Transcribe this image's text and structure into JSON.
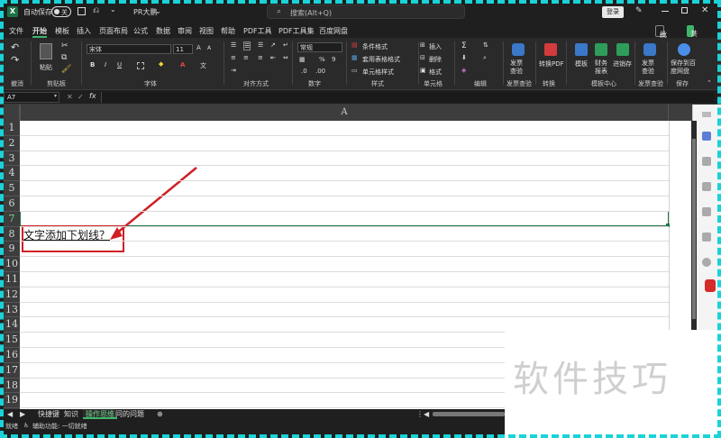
{
  "titlebar": {
    "autosave_label": "自动保存",
    "autosave_state": "关",
    "filename": "PR大鹏",
    "search_placeholder": "搜索(Alt+Q)",
    "login": "登录"
  },
  "tabs": [
    "文件",
    "开始",
    "模板",
    "插入",
    "页面布局",
    "公式",
    "数据",
    "审阅",
    "视图",
    "帮助",
    "PDF工具",
    "PDF工具集",
    "百度网盘"
  ],
  "active_tab": "开始",
  "ribbon_buttons": {
    "comment": "批注",
    "share": "共享"
  },
  "ribbon": {
    "undo_group": "撤消",
    "clipboard": {
      "paste": "粘贴",
      "group": "剪贴板"
    },
    "font": {
      "name": "宋体",
      "size": "11",
      "group": "字体",
      "bold": "B",
      "italic": "I",
      "underline": "U"
    },
    "alignment": {
      "group": "对齐方式"
    },
    "number": {
      "format": "常规",
      "group": "数字",
      "percent": "%"
    },
    "styles": {
      "conditional": "条件格式",
      "table": "套用表格格式",
      "cell": "单元格样式",
      "group": "样式"
    },
    "cells": {
      "insert": "插入",
      "delete": "删除",
      "format": "格式",
      "group": "单元格"
    },
    "editing": {
      "group": "编辑"
    },
    "invoice": {
      "label": "发票查验",
      "group": "发票查验"
    },
    "convert": {
      "label": "转换PDF",
      "group": "转换"
    },
    "templates": {
      "t1": "模板",
      "t2": "财务报表",
      "t3": "进销存",
      "group": "模板中心"
    },
    "invoice2": {
      "label": "发票查验",
      "group": "发票查验"
    },
    "save": {
      "label": "保存到百度网盘",
      "group": "保存"
    }
  },
  "formula_bar": {
    "name_box": "A7",
    "fx": "fx"
  },
  "sheet": {
    "column": "A",
    "rows": [
      "1",
      "2",
      "3",
      "4",
      "5",
      "6",
      "7",
      "8",
      "9",
      "10",
      "11",
      "12",
      "13",
      "14",
      "15",
      "16",
      "17",
      "18",
      "19"
    ],
    "selected_row": "7",
    "cell_A8": "文字添加下划线？"
  },
  "sheet_tabs": [
    "快捷键",
    "知识",
    "操作思维",
    "问的问题"
  ],
  "active_sheet": "操作思维",
  "status": {
    "ready": "就绪",
    "accessibility": "辅助功能: 一切就绪"
  },
  "watermark": "软件技巧",
  "colors": {
    "accent": "#3fb56b",
    "annotation": "#d01f25",
    "border": "#19d3d8"
  }
}
